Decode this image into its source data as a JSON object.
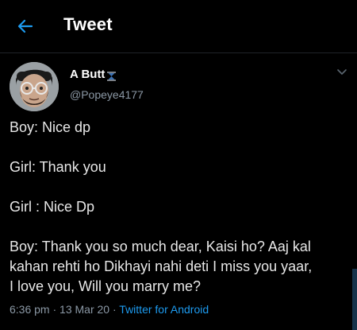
{
  "header": {
    "title": "Tweet",
    "back_icon": "arrow-left-icon",
    "accent_color": "#1d9bf0"
  },
  "author": {
    "name": "A Butt",
    "name_emoji_icon": "hourglass-emoji-icon",
    "handle": "@Popeye4177",
    "avatar_icon": "profile-photo"
  },
  "tweet": {
    "lines": [
      "Boy: Nice dp",
      "",
      "Girl: Thank you",
      "",
      "Girl : Nice Dp",
      "",
      "Boy: Thank you so much dear, Kaisi ho? Aaj kal",
      "kahan rehti ho Dikhayi nahi deti I miss you yaar,",
      "I love you, Will you marry me?"
    ]
  },
  "meta": {
    "time": "6:36 pm",
    "sep1": " · ",
    "date": "13 Mar 20",
    "sep2": " · ",
    "source": "Twitter for Android",
    "source_color": "#1d9bf0"
  },
  "menu": {
    "chevron_icon": "chevron-down-icon"
  }
}
